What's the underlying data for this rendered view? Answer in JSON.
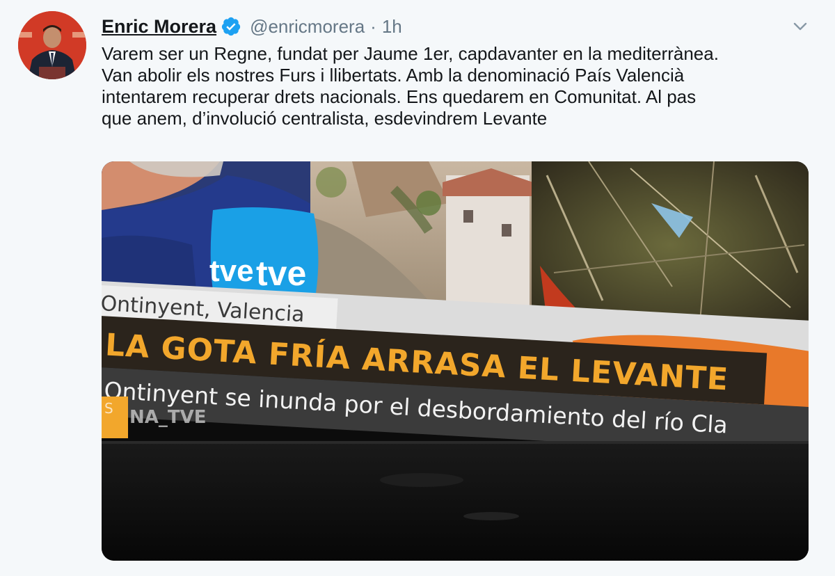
{
  "tweet": {
    "author_name": "Enric Morera",
    "handle": "@enricmorera",
    "separator": "·",
    "time": "1h",
    "text_lines": [
      "Varem ser un Regne, fundat per Jaume 1er, capdavanter en la mediterrànea.",
      "Van abolir els nostres Furs i llibertats. Amb la denominació País Valencià",
      "intentarem recuperar drets nacionals. Ens quedarem en Comunitat. Al pas",
      "que anem, d’involució centralista,  esdevindrem Levante"
    ]
  },
  "media": {
    "mic_logo": "tve",
    "mic_logo_2": "tve",
    "location": "Ontinyent, Valencia",
    "headline": "LA GOTA FRÍA ARRASA EL LEVANTE",
    "subheadline": "Ontinyent se inunda por el desbordamiento del río Cla",
    "channel_tag": "NA_TVE",
    "channel_tag_prefix": "S"
  },
  "icons": {
    "verified": "verified-badge-icon",
    "caret": "chevron-down-icon"
  },
  "colors": {
    "verified_blue": "#1da1f2",
    "orange_banner": "#e8792a",
    "headline_yellow": "#f2a72c"
  }
}
